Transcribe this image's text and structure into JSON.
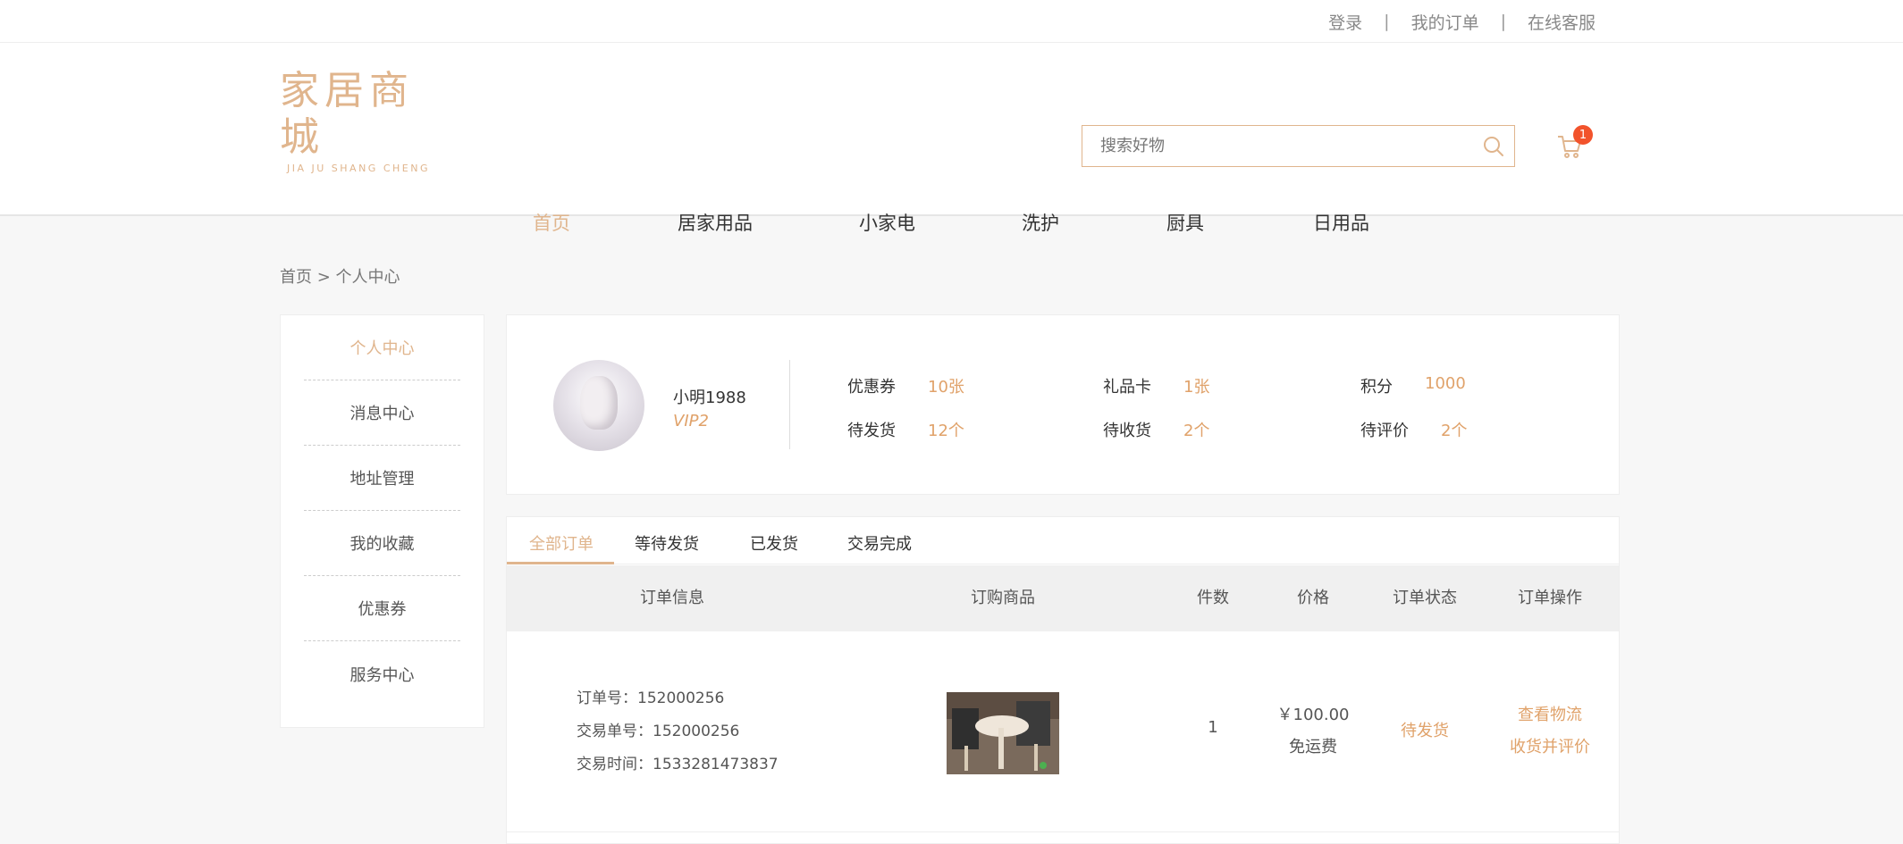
{
  "topbar": {
    "login": "登录",
    "orders": "我的订单",
    "service": "在线客服",
    "separator": "|"
  },
  "logo": {
    "cn": "家居商城",
    "en": "JIA JU SHANG CHENG"
  },
  "search": {
    "placeholder": "搜索好物",
    "value": ""
  },
  "cart": {
    "count": "1"
  },
  "nav": [
    "首页",
    "居家用品",
    "小家电",
    "洗护",
    "厨具",
    "日用品"
  ],
  "breadcrumb": "首页 > 个人中心",
  "sidebar": [
    "个人中心",
    "消息中心",
    "地址管理",
    "我的收藏",
    "优惠券",
    "服务中心"
  ],
  "profile": {
    "username": "小明1988",
    "level": "VIP2",
    "stats": [
      {
        "label": "优惠券",
        "value": "10张"
      },
      {
        "label": "礼品卡",
        "value": "1张"
      },
      {
        "label": "积分",
        "value": "1000"
      },
      {
        "label": "待发货",
        "value": "12个"
      },
      {
        "label": "待收货",
        "value": "2个"
      },
      {
        "label": "待评价",
        "value": "2个"
      }
    ]
  },
  "tabs": [
    "全部订单",
    "等待发货",
    "已发货",
    "交易完成"
  ],
  "table": {
    "headers": [
      "订单信息",
      "订购商品",
      "件数",
      "价格",
      "订单状态",
      "订单操作"
    ],
    "rows": [
      {
        "order_no": "订单号：152000256",
        "trade_no": "交易单号：152000256",
        "time": "交易时间：1533281473837",
        "qty": "1",
        "price": "￥100.00",
        "shipping": "免运费",
        "status": "待发货",
        "action1": "查看物流",
        "action2": "收货并评价"
      }
    ]
  },
  "colors": {
    "accent": "#e0b58d",
    "highlight": "#e0a26a",
    "badge": "#f2532c"
  }
}
